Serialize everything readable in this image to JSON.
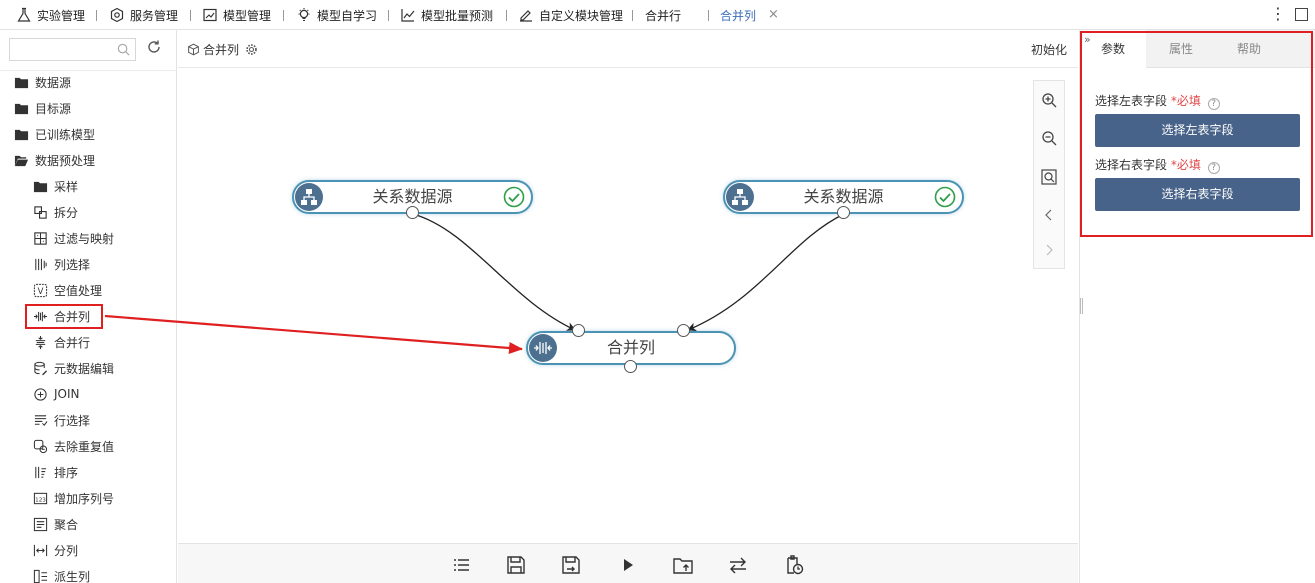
{
  "top_tabs": [
    {
      "label": "实验管理",
      "icon": "flask-icon"
    },
    {
      "label": "服务管理",
      "icon": "service-icon"
    },
    {
      "label": "模型管理",
      "icon": "chart-box-icon"
    },
    {
      "label": "模型自学习",
      "icon": "bulb-icon"
    },
    {
      "label": "模型批量预测",
      "icon": "trend-icon"
    },
    {
      "label": "自定义模块管理",
      "icon": "pencil-doc-icon"
    },
    {
      "label": "合并行"
    },
    {
      "label": "合并列",
      "active": true
    }
  ],
  "tab_close": "×",
  "sidebar": {
    "search_placeholder": "",
    "folders": [
      {
        "label": "数据源",
        "icon": "folder-icon"
      },
      {
        "label": "目标源",
        "icon": "folder-icon"
      },
      {
        "label": "已训练模型",
        "icon": "folder-icon"
      },
      {
        "label": "数据预处理",
        "icon": "folder-open-icon"
      }
    ],
    "items": [
      {
        "label": "采样",
        "icon": "folder-icon"
      },
      {
        "label": "拆分",
        "icon": "split-icon"
      },
      {
        "label": "过滤与映射",
        "icon": "filter-map-icon"
      },
      {
        "label": "列选择",
        "icon": "column-select-icon"
      },
      {
        "label": "空值处理",
        "icon": "null-handle-icon"
      },
      {
        "label": "合并列",
        "icon": "merge-column-icon"
      },
      {
        "label": "合并行",
        "icon": "merge-row-icon"
      },
      {
        "label": "元数据编辑",
        "icon": "database-icon"
      },
      {
        "label": "JOIN",
        "icon": "join-icon"
      },
      {
        "label": "行选择",
        "icon": "row-select-icon"
      },
      {
        "label": "去除重复值",
        "icon": "dedupe-icon"
      },
      {
        "label": "排序",
        "icon": "sort-icon"
      },
      {
        "label": "增加序列号",
        "icon": "sequence-icon"
      },
      {
        "label": "聚合",
        "icon": "aggregate-icon"
      },
      {
        "label": "分列",
        "icon": "split-column-icon"
      },
      {
        "label": "派生列",
        "icon": "derive-column-icon"
      }
    ]
  },
  "canvas": {
    "breadcrumb": "合并列",
    "init_label": "初始化",
    "nodes": [
      {
        "id": "src-left",
        "label": "关系数据源",
        "status": "success"
      },
      {
        "id": "src-right",
        "label": "关系数据源",
        "status": "success"
      },
      {
        "id": "merge",
        "label": "合并列",
        "status": "selected"
      }
    ]
  },
  "right_panel": {
    "tabs": [
      "参数",
      "属性",
      "帮助"
    ],
    "active_tab": "参数",
    "collapse_glyph": "»",
    "required_mark": "*必填",
    "help_glyph": "?",
    "fields": [
      {
        "label": "选择左表字段",
        "button": "选择左表字段"
      },
      {
        "label": "选择右表字段",
        "button": "选择右表字段"
      }
    ]
  },
  "colors": {
    "accent": "#3d6fb8",
    "node_border": "#4a93b4",
    "button": "#486389",
    "annotation": "#e02020",
    "success": "#2e9e4a"
  }
}
